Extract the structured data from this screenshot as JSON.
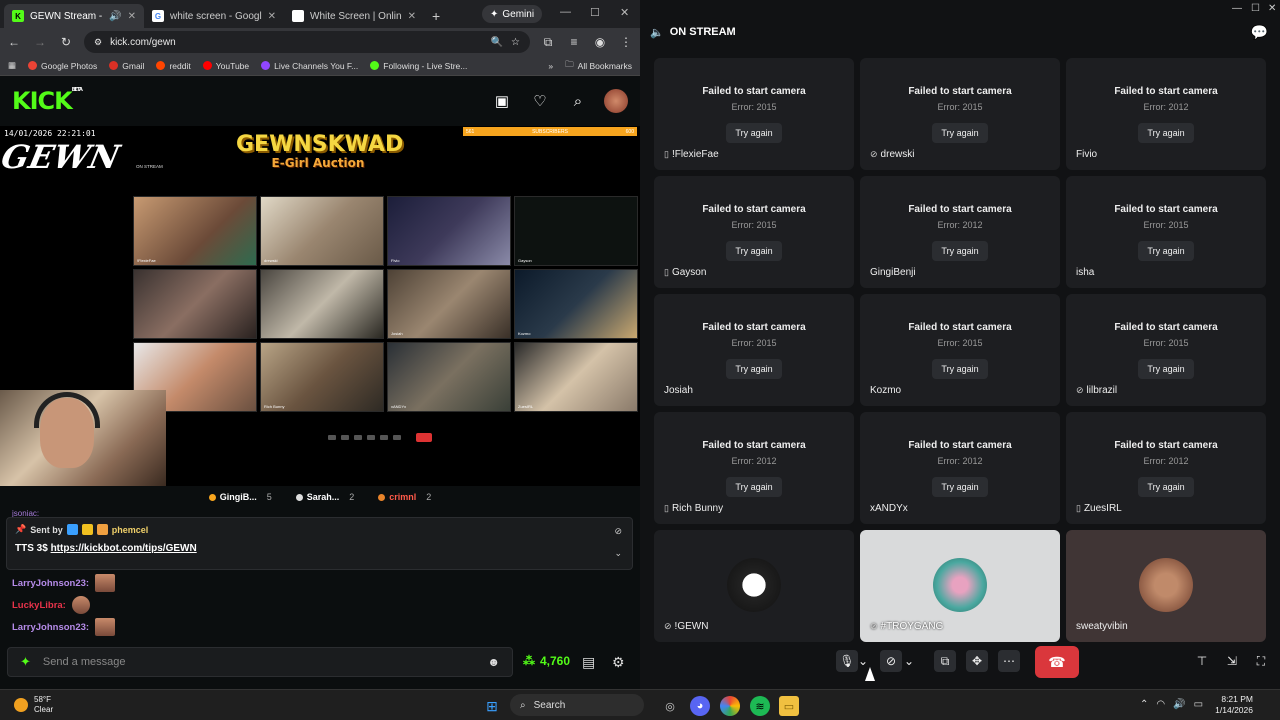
{
  "browser": {
    "tabs": [
      {
        "title": "GEWN Stream - Watc",
        "fav_color": "#53fc18",
        "fav_letter": "K"
      },
      {
        "title": "white screen - Google Se",
        "fav_color": "#ffffff",
        "fav_letter": "G"
      },
      {
        "title": "White Screen | Online To",
        "fav_color": "#ffffff",
        "fav_letter": ""
      }
    ],
    "gemini_tab": "Gemini",
    "url": "kick.com/gewn",
    "bookmarks": [
      {
        "label": "Google Photos",
        "color": "#ea4335"
      },
      {
        "label": "Gmail",
        "color": "#d93025"
      },
      {
        "label": "reddit",
        "color": "#ff4500"
      },
      {
        "label": "YouTube",
        "color": "#ff0000"
      },
      {
        "label": "Live Channels You F...",
        "color": "#9146ff"
      },
      {
        "label": "Following - Live Stre...",
        "color": "#53fc18"
      }
    ],
    "all_bookmarks": "All Bookmarks"
  },
  "kick": {
    "logo": "KICK",
    "logo_badge": "BETA",
    "accent": "#53fc18"
  },
  "stream": {
    "timestamp": "14/01/2026 22:21:01",
    "logo_text": "GEWN",
    "title_line1": "GEWNSKWAD",
    "title_line2": "E-Girl Auction",
    "sub_bar_left": "561",
    "sub_bar_label": "SUBSCRIBERS",
    "sub_bar_right": "600",
    "inner_on_stream": "ON STREAM",
    "grid_names": [
      "!FlexieFae",
      "drewski",
      "Fivio",
      "Gayson",
      "",
      "",
      "Josiah",
      "Kozmo",
      "",
      "Rich Bunny",
      "xANDYx",
      "ZuesIRL"
    ]
  },
  "leaderboard": [
    {
      "name": "GingiB...",
      "count": "5",
      "color": "#f7a51e"
    },
    {
      "name": "Sarah...",
      "count": "2",
      "color": "#dddddd"
    },
    {
      "name": "crimnl",
      "count": "2",
      "color": "#e8832a",
      "name_color": "#ff5a4a"
    }
  ],
  "pinned": {
    "sent_by": "Sent by",
    "user": "phemcel",
    "message": "TTS 3$",
    "link": "https://kickbot.com/tips/GEWN"
  },
  "chat_peek": "jsoniac:",
  "chat": [
    {
      "user": "LarryJohnson23:",
      "color": "#b58be8"
    },
    {
      "user": "LuckyLibra:",
      "color": "#e8334a"
    },
    {
      "user": "LarryJohnson23:",
      "color": "#b58be8"
    }
  ],
  "send_placeholder": "Send a message",
  "points": "4,760",
  "discord": {
    "header": "ON STREAM",
    "fail_title": "Failed to start camera",
    "try_again": "Try again",
    "tiles": [
      {
        "name": "!FlexieFae",
        "error": "Error: 2015",
        "icon": "phone"
      },
      {
        "name": "drewski",
        "error": "Error: 2015",
        "icon": "muted"
      },
      {
        "name": "Fivio",
        "error": "Error: 2012",
        "icon": ""
      },
      {
        "name": "Gayson",
        "error": "Error: 2015",
        "icon": "phone"
      },
      {
        "name": "GingiBenji",
        "error": "Error: 2012",
        "icon": ""
      },
      {
        "name": "isha",
        "error": "Error: 2015",
        "icon": ""
      },
      {
        "name": "Josiah",
        "error": "Error: 2015",
        "icon": ""
      },
      {
        "name": "Kozmo",
        "error": "Error: 2015",
        "icon": ""
      },
      {
        "name": "lilbrazil",
        "error": "Error: 2015",
        "icon": "muted"
      },
      {
        "name": "Rich Bunny",
        "error": "Error: 2012",
        "icon": "phone"
      },
      {
        "name": "xANDYx",
        "error": "Error: 2012",
        "icon": ""
      },
      {
        "name": "ZuesIRL",
        "error": "Error: 2012",
        "icon": "phone"
      }
    ],
    "avatar_tiles": [
      {
        "name": "!GEWN",
        "icon": "muted"
      },
      {
        "name": "#TROYGANG",
        "icon": "muted"
      },
      {
        "name": "sweatyvibin",
        "icon": ""
      }
    ]
  },
  "taskbar": {
    "temp": "58°F",
    "cond": "Clear",
    "search": "Search",
    "time": "8:21 PM",
    "date": "1/14/2026"
  }
}
